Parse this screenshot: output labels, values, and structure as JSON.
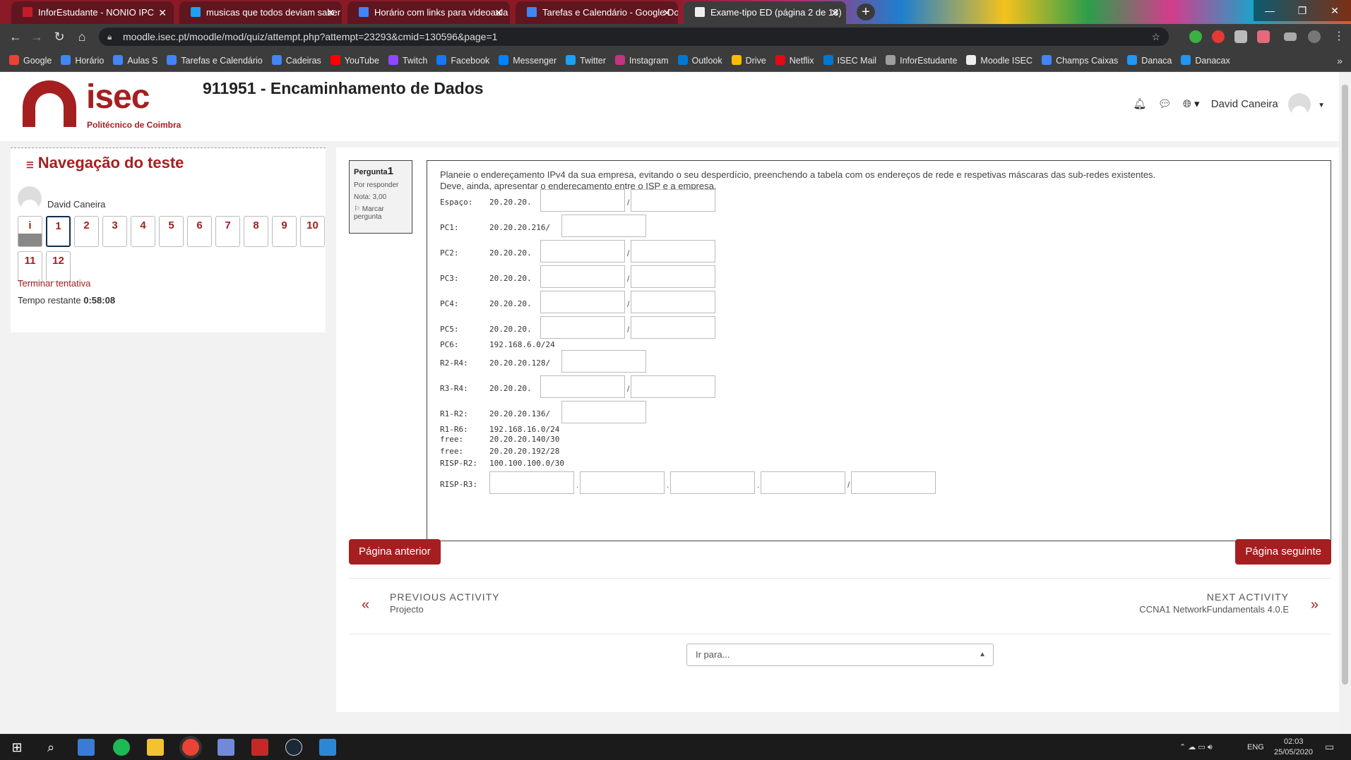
{
  "tabs": [
    {
      "title": "InforEstudante - NONIO IPC",
      "fav": "#c21d2d"
    },
    {
      "title": "musicas que todos deviam saber",
      "fav": "#1da1f2"
    },
    {
      "title": "Horário com links para videoaula",
      "fav": "#4285f4"
    },
    {
      "title": "Tarefas e Calendário - Google Do",
      "fav": "#4285f4"
    },
    {
      "title": "Exame-tipo ED (página 2 de 13)",
      "fav": "#eeeeee"
    }
  ],
  "tab_close": "✕",
  "new_tab": "+",
  "window": {
    "minimize": "—",
    "restore": "❐",
    "close": "✕"
  },
  "url": "moodle.isec.pt/moodle/mod/quiz/attempt.php?attempt=23293&cmid=130596&page=1",
  "bookmarks": [
    {
      "label": "Google",
      "color": "#ea4335"
    },
    {
      "label": "Horário",
      "color": "#4285f4"
    },
    {
      "label": "Aulas S",
      "color": "#4285f4"
    },
    {
      "label": "Tarefas e Calendário",
      "color": "#4285f4"
    },
    {
      "label": "Cadeiras",
      "color": "#4285f4"
    },
    {
      "label": "YouTube",
      "color": "#ff0000"
    },
    {
      "label": "Twitch",
      "color": "#9146ff"
    },
    {
      "label": "Facebook",
      "color": "#1877f2"
    },
    {
      "label": "Messenger",
      "color": "#0084ff"
    },
    {
      "label": "Twitter",
      "color": "#1da1f2"
    },
    {
      "label": "Instagram",
      "color": "#c13584"
    },
    {
      "label": "Outlook",
      "color": "#0078d4"
    },
    {
      "label": "Drive",
      "color": "#fbbc04"
    },
    {
      "label": "Netflix",
      "color": "#e50914"
    },
    {
      "label": "ISEC Mail",
      "color": "#0078d4"
    },
    {
      "label": "InforEstudante",
      "color": "#9e9e9e"
    },
    {
      "label": "Moodle ISEC",
      "color": "#eeeeee"
    },
    {
      "label": "Champs Caixas",
      "color": "#4285f4"
    },
    {
      "label": "Danaca",
      "color": "#2196f3"
    },
    {
      "label": "Danacax",
      "color": "#2196f3"
    }
  ],
  "bookmarks_more": "»",
  "site": {
    "logo_text": "isec",
    "logo_sub": "Politécnico de Coimbra",
    "course_title": "911951 - Encaminhamento de Dados",
    "user": "David Caneira"
  },
  "nav": {
    "title": "Navegação do teste",
    "user": "David Caneira",
    "questions": [
      "i",
      "1",
      "2",
      "3",
      "4",
      "5",
      "6",
      "7",
      "8",
      "9",
      "10",
      "11",
      "12"
    ],
    "finish": "Terminar tentativa",
    "time_label": "Tempo restante",
    "time_value": "0:58:08"
  },
  "qinfo": {
    "label": "Pergunta",
    "number": "1",
    "state": "Por responder",
    "grade": "Nota: 3,00",
    "flag": "Marcar pergunta"
  },
  "question": {
    "text1": "Planeie o endereçamento IPv4 da sua empresa, evitando o seu desperdício, preenchendo a tabela com os endereços de rede e respetivas máscaras das sub-redes existentes.",
    "text2": "Deve, ainda, apresentar o endereçamento entre o ISP e a empresa.",
    "rows": [
      {
        "label": "Espaço:",
        "prefix": "20.20.20.",
        "kind": "two"
      },
      {
        "label": "PC1:",
        "prefix": "20.20.20.216/",
        "kind": "one"
      },
      {
        "label": "PC2:",
        "prefix": "20.20.20.",
        "kind": "two"
      },
      {
        "label": "PC3:",
        "prefix": "20.20.20.",
        "kind": "two"
      },
      {
        "label": "PC4:",
        "prefix": "20.20.20.",
        "kind": "two"
      },
      {
        "label": "PC5:",
        "prefix": "20.20.20.",
        "kind": "two"
      },
      {
        "label": "PC6:",
        "prefix": "192.168.6.0/24",
        "kind": "none"
      },
      {
        "label": "R2-R4:",
        "prefix": "20.20.20.128/",
        "kind": "one"
      },
      {
        "label": "R3-R4:",
        "prefix": "20.20.20.",
        "kind": "two"
      },
      {
        "label": "R1-R2:",
        "prefix": "20.20.20.136/",
        "kind": "one"
      },
      {
        "label": "R1-R6:",
        "prefix": "192.168.16.0/24",
        "kind": "none"
      },
      {
        "label": "free:",
        "prefix": "20.20.20.140/30",
        "kind": "none"
      },
      {
        "label": "free:",
        "prefix": "20.20.20.192/28",
        "kind": "none"
      },
      {
        "label": "RISP-R2:",
        "prefix": "100.100.100.0/30",
        "kind": "none"
      },
      {
        "label": "RISP-R3:",
        "prefix": "",
        "kind": "five"
      }
    ]
  },
  "buttons": {
    "prev": "Página anterior",
    "next": "Página seguinte"
  },
  "activity": {
    "prev_heading": "PREVIOUS ACTIVITY",
    "prev_name": "Projecto",
    "next_heading": "NEXT ACTIVITY",
    "next_name": "CCNA1 NetworkFundamentals 4.0.E"
  },
  "jump": {
    "placeholder": "Ir para..."
  },
  "taskbar": {
    "lang": "ENG",
    "time": "02:03",
    "date": "25/05/2020"
  }
}
